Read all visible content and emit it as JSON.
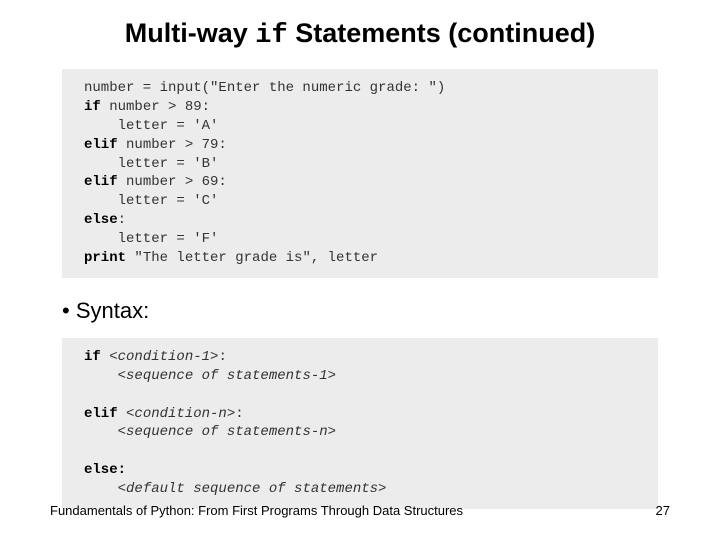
{
  "title": {
    "pre": "Multi-way ",
    "code": "if",
    "post": " Statements (continued)"
  },
  "code1": {
    "l1a": "number = input(\"Enter the numeric grade: \")",
    "l2a": "if",
    "l2b": " number > 89:",
    "l3a": "    letter = 'A'",
    "l4a": "elif",
    "l4b": " number > 79:",
    "l5a": "    letter = 'B'",
    "l6a": "elif",
    "l6b": " number > 69:",
    "l7a": "    letter = 'C'",
    "l8a": "else",
    "l8b": ":",
    "l9a": "    letter = 'F'",
    "l10a": "print",
    "l10b": " \"The letter grade is\", letter"
  },
  "bullet1": "•   Syntax:",
  "code2": {
    "l1a": "if ",
    "l1b": "<condition-1>",
    "l1c": ":",
    "l2a": "    ",
    "l2b": "<sequence of statements-1>",
    "blank1": "",
    "l3a": "elif ",
    "l3b": "<condition-n>",
    "l3c": ":",
    "l4a": "    ",
    "l4b": "<sequence of statements-n>",
    "blank2": "",
    "l5a": "else:",
    "l6a": "    ",
    "l6b": "<default sequence of statements>"
  },
  "footer": "Fundamentals of Python: From First Programs Through Data Structures",
  "page": "27"
}
